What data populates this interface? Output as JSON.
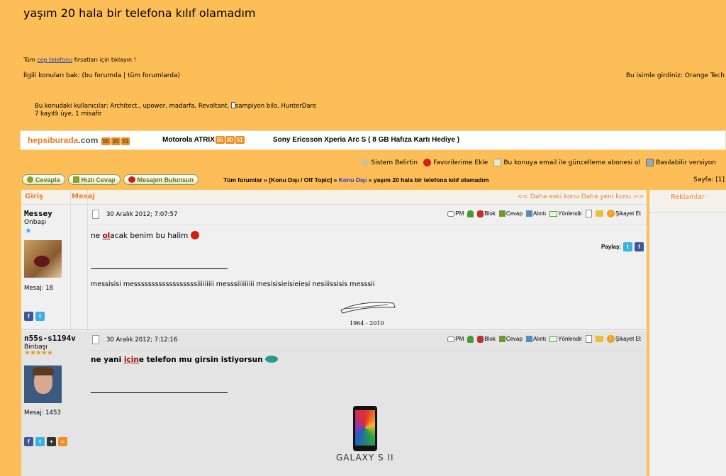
{
  "thread_title": "yaşım 20 hala bir telefona kılıf olamadım",
  "promo": {
    "prefix": "Tüm ",
    "link": "cep telefonu",
    "suffix": " fırsatları için tıklayın !"
  },
  "related": "İlgili konuları bak: (bu forumda | tüm forumlarda)",
  "login": "Bu isimle girdiniz: Orange Tech",
  "users_line1": "Bu konudaki kullanıcılar: Architect., upower, madarfa, Revoltant, ",
  "users_line1b": "sampiyon bilo, HunterDare",
  "users_line2": "7 kayıtlı üye, 1 misafir",
  "ad": {
    "brand": "hepsiburada",
    "brand_suffix": ".com",
    "timer": [
      "55",
      "30",
      "51"
    ],
    "item1": "Motorola ATRIX",
    "item2": "Sony Ericsson Xperia Arc S ( 8 GB Hafıza Kartı Hediye )"
  },
  "tools": [
    "Sistem Belirtin",
    "Favorilerime Ekle",
    "Bu konuya email ile güncelleme abonesi ol",
    "Basılabilir versiyon"
  ],
  "buttons": [
    "Cevapla",
    "Hızlı Cevap",
    "Mesajım Bulunsun"
  ],
  "breadcrumb": {
    "a": "Tüm forumlar » [Konu Dışı / Off Topic] » ",
    "b": "Konu Dışı",
    "c": " » yaşım 20 hala bir telefona kılıf olamadım"
  },
  "page": "Sayfa: [1]",
  "header": {
    "col1": "Giriş",
    "col2": "Mesaj",
    "nav": "<< Daha eski konu   Daha yeni konu >>"
  },
  "ads_header": "Reklamlar",
  "actions": [
    "PM",
    "Blok",
    "Cevap",
    "Alıntı",
    "Yönlendir",
    "Şikayet Et"
  ],
  "share": "Paylaş:",
  "posts": [
    {
      "user": "Messey",
      "rank": "Onbaşı",
      "msg_count": "Mesaj: 18",
      "date": "30 Aralık 2012; 7:07:57",
      "text_pre": "ne ",
      "text_hl": "ol",
      "text_post": "acak benim bu halim",
      "sig": "messisisi messssssssssssssssssiiiiiiiii messsiiiiiiiii mesisisieisieiesi nesiiissisis messsii",
      "sig_years": "1964 - 2010"
    },
    {
      "user": "n55s-s1194v",
      "rank": "Binbaşı",
      "msg_count": "Mesaj: 1453",
      "date": "30 Aralık 2012; 7:12:16",
      "text_pre": "ne yani ",
      "text_hl": "için",
      "text_post": "e telefon mu girsin istiyorsun",
      "sig_brand": "GALAXY S II"
    }
  ]
}
